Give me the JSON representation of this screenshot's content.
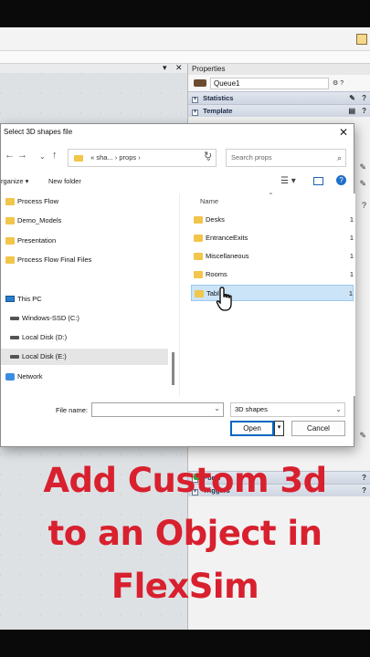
{
  "properties_panel": {
    "title": "Properties",
    "object_name": "Queue1",
    "sections_top": [
      "Statistics",
      "Template"
    ],
    "sections_bottom": [
      "Ports",
      "Triggers"
    ],
    "help_glyph": "?"
  },
  "dialog": {
    "title": "Select 3D shapes file",
    "close_glyph": "✕",
    "nav": {
      "back": "←",
      "forward": "→",
      "up": "↑"
    },
    "breadcrumb": "« sha...  ›  props  ›",
    "refresh": "↻",
    "search_placeholder": "Search props",
    "organize": "rganize ▾",
    "new_folder": "New folder",
    "view_glyph": "☰ ▾",
    "help": "?",
    "nav_pane": [
      {
        "label": "Process Flow",
        "icon": "folder-icon"
      },
      {
        "label": "Demo_Models",
        "icon": "folder-icon"
      },
      {
        "label": "Presentation",
        "icon": "folder-icon"
      },
      {
        "label": "Process Flow Final Files",
        "icon": "folder-icon"
      },
      {
        "label": "This PC",
        "icon": "pc-icon"
      },
      {
        "label": "Windows-SSD (C:)",
        "icon": "disk-icon"
      },
      {
        "label": "Local Disk (D:)",
        "icon": "disk-icon"
      },
      {
        "label": "Local Disk (E:)",
        "icon": "disk-icon"
      },
      {
        "label": "Network",
        "icon": "network-icon"
      }
    ],
    "column_header": "Name",
    "folders": [
      {
        "name": "Desks",
        "tail": "1"
      },
      {
        "name": "EntranceExits",
        "tail": "1"
      },
      {
        "name": "Miscellaneous",
        "tail": "1"
      },
      {
        "name": "Rooms",
        "tail": "1"
      },
      {
        "name": "Tabl",
        "tail": "1"
      }
    ],
    "file_name_label": "File name:",
    "file_name_value": "",
    "file_type": "3D shapes",
    "open_label": "Open",
    "cancel_label": "Cancel"
  },
  "caption": {
    "line1": "Add Custom 3d",
    "line2": "to an Object in",
    "line3": "FlexSim"
  },
  "colors": {
    "caption": "#d8202e",
    "selection": "#cce4f7",
    "accent": "#0067c0"
  }
}
